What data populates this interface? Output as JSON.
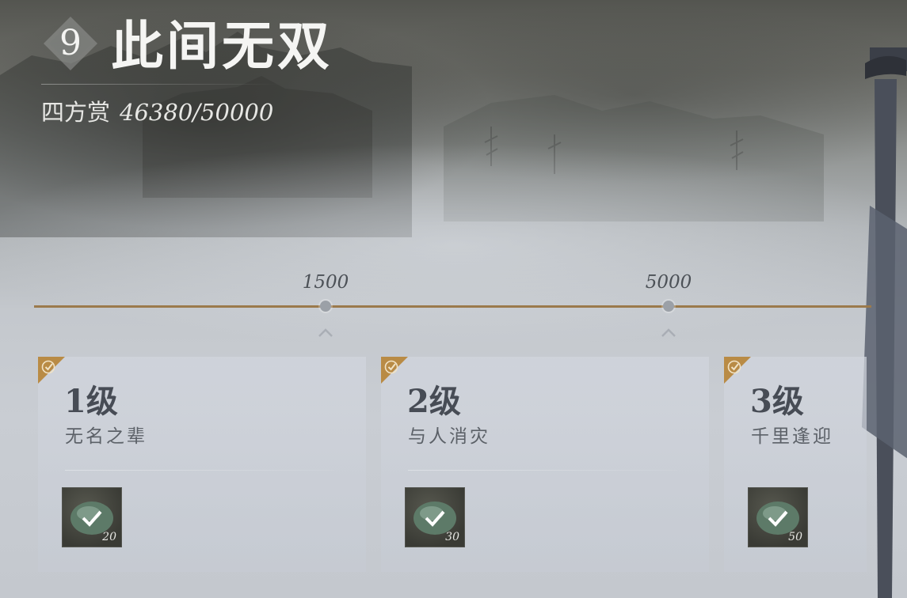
{
  "header": {
    "chapter_number": "9",
    "title": "此间无双",
    "reward_label": "四方赏",
    "reward_progress": "46380/50000"
  },
  "timeline": {
    "milestones": [
      {
        "label": "1500"
      },
      {
        "label": "5000"
      }
    ]
  },
  "cards": [
    {
      "level": "1级",
      "subtitle": "无名之辈",
      "item_qty": "20",
      "claimed": true
    },
    {
      "level": "2级",
      "subtitle": "与人消灾",
      "item_qty": "30",
      "claimed": true
    },
    {
      "level": "3级",
      "subtitle": "千里逢迎",
      "item_qty": "50",
      "claimed": true
    }
  ],
  "colors": {
    "timeline": "#9b7a4c",
    "corner_badge": "#b98b45",
    "title_text": "#f5f5f3"
  },
  "icons": {
    "chapter_badge": "diamond-badge-icon",
    "milestone_marker": "caret-up-icon",
    "claimed_marker": "corner-check-icon",
    "reward_item": "jade-token-check-icon"
  }
}
